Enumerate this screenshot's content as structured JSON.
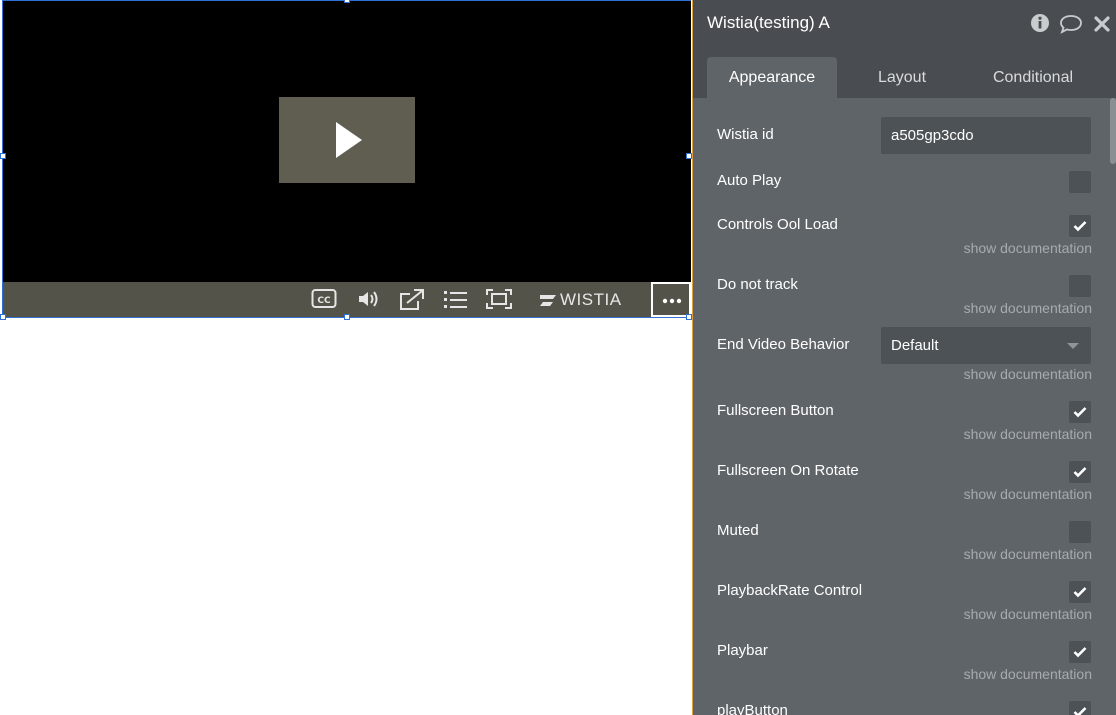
{
  "video_player": {
    "brand": "WISTIA",
    "controls": [
      {
        "name": "closed-captions-icon"
      },
      {
        "name": "volume-icon"
      },
      {
        "name": "share-icon"
      },
      {
        "name": "chapters-list-icon"
      },
      {
        "name": "fullscreen-icon"
      },
      {
        "name": "more-options-icon"
      }
    ]
  },
  "panel": {
    "title": "Wistia(testing) A",
    "header_icons": [
      "info-icon",
      "comment-icon",
      "close-icon"
    ],
    "tabs": [
      {
        "label": "Appearance",
        "active": true
      },
      {
        "label": "Layout",
        "active": false
      },
      {
        "label": "Conditional",
        "active": false
      }
    ],
    "doc_link": "show documentation",
    "properties": {
      "wistia_id": {
        "label": "Wistia id",
        "value": "a505gp3cdo"
      },
      "auto_play": {
        "label": "Auto Play",
        "checked": false
      },
      "controls_on_load": {
        "label": "Controls Ool Load",
        "checked": true
      },
      "do_not_track": {
        "label": "Do not track",
        "checked": false
      },
      "end_video_behavior": {
        "label": "End Video Behavior",
        "value": "Default"
      },
      "fullscreen_button": {
        "label": "Fullscreen Button",
        "checked": true
      },
      "fullscreen_on_rotate": {
        "label": "Fullscreen On Rotate",
        "checked": true
      },
      "muted": {
        "label": "Muted",
        "checked": false
      },
      "playback_rate_control": {
        "label": "PlaybackRate Control",
        "checked": true
      },
      "playbar": {
        "label": "Playbar",
        "checked": true
      },
      "play_button": {
        "label": "playButton",
        "checked": true
      }
    }
  },
  "colors": {
    "panel_bg": "#5f6468",
    "panel_header": "#494d51",
    "video_bg": "#000000",
    "controlbar": "#545349",
    "selection": "#2f6fd6"
  }
}
